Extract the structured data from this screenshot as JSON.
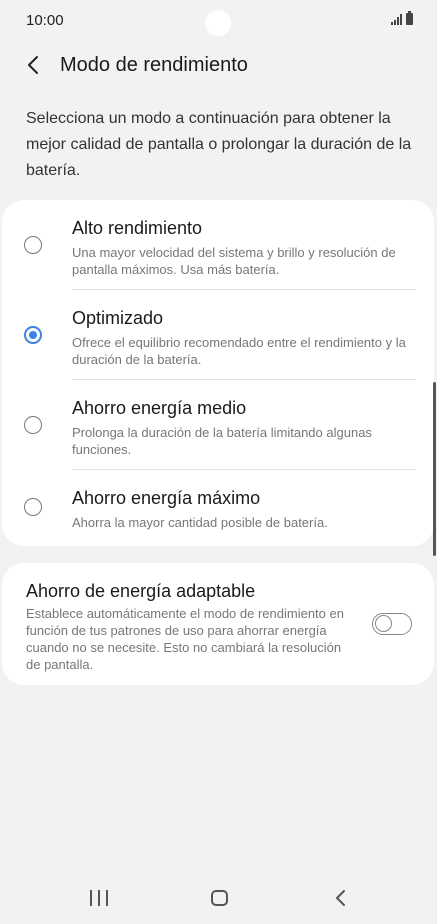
{
  "status_bar": {
    "time": "10:00"
  },
  "header": {
    "title": "Modo de rendimiento"
  },
  "description": "Selecciona un modo a continuación para obtener la mejor calidad de pantalla o prolongar la duración de la batería.",
  "modes": [
    {
      "title": "Alto rendimiento",
      "description": "Una mayor velocidad del sistema y brillo y resolución de pantalla máximos. Usa más batería.",
      "selected": false
    },
    {
      "title": "Optimizado",
      "description": "Ofrece el equilibrio recomendado entre el rendimiento y la duración de la batería.",
      "selected": true
    },
    {
      "title": "Ahorro energía medio",
      "description": "Prolonga la duración de la batería limitando algunas funciones.",
      "selected": false
    },
    {
      "title": "Ahorro energía máximo",
      "description": "Ahorra la mayor cantidad posible de batería.",
      "selected": false
    }
  ],
  "adaptive": {
    "title": "Ahorro de energía adaptable",
    "description": "Establece automáticamente el modo de rendimiento en función de tus patrones de uso para ahorrar energía cuando no se necesite. Esto no cambiará la resolución de pantalla.",
    "enabled": false
  },
  "colors": {
    "accent": "#3e82e4",
    "background": "#f2f2f2",
    "card": "#ffffff"
  },
  "icons": [
    "back-arrow-icon",
    "signal-icon",
    "battery-icon",
    "recents-icon",
    "home-icon",
    "nav-back-icon"
  ]
}
